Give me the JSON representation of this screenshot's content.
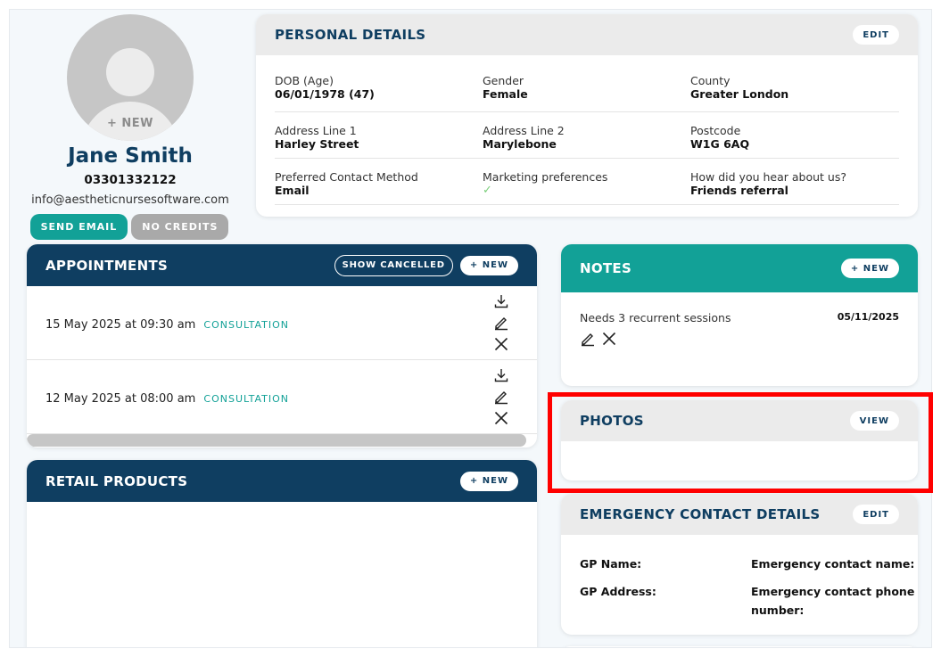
{
  "profile": {
    "avatar_new_label": "+ NEW",
    "name": "Jane Smith",
    "phone": "03301332122",
    "email": "info@aestheticnursesoftware.com",
    "send_email_label": "SEND EMAIL",
    "no_credits_label": "NO CREDITS"
  },
  "personal_details": {
    "title": "PERSONAL DETAILS",
    "edit_label": "EDIT",
    "rows": [
      [
        {
          "label": "DOB (Age)",
          "value": "06/01/1978 (47)"
        },
        {
          "label": "Gender",
          "value": "Female"
        },
        {
          "label": "County",
          "value": "Greater London"
        }
      ],
      [
        {
          "label": "Address Line 1",
          "value": "Harley Street"
        },
        {
          "label": "Address Line 2",
          "value": "Marylebone"
        },
        {
          "label": "Postcode",
          "value": "W1G 6AQ"
        }
      ],
      [
        {
          "label": "Preferred Contact Method",
          "value": "Email"
        },
        {
          "label": "Marketing preferences",
          "value": "✓"
        },
        {
          "label": "How did you hear about us?",
          "value": "Friends referral"
        }
      ]
    ]
  },
  "appointments": {
    "title": "APPOINTMENTS",
    "show_cancelled_label": "SHOW CANCELLED",
    "new_label": "+ NEW",
    "items": [
      {
        "datetime": "15 May 2025 at 09:30 am",
        "type": "CONSULTATION"
      },
      {
        "datetime": "12 May 2025 at 08:00 am",
        "type": "CONSULTATION"
      }
    ]
  },
  "retail_products": {
    "title": "RETAIL PRODUCTS",
    "new_label": "+ NEW"
  },
  "notes": {
    "title": "NOTES",
    "new_label": "+ NEW",
    "items": [
      {
        "text": "Needs 3 recurrent sessions",
        "date": "05/11/2025"
      }
    ]
  },
  "photos": {
    "title": "PHOTOS",
    "view_label": "VIEW"
  },
  "emergency": {
    "title": "EMERGENCY CONTACT DETAILS",
    "edit_label": "EDIT",
    "gp_name_label": "GP Name:",
    "gp_address_label": "GP Address:",
    "contact_name_label": "Emergency contact name:",
    "contact_phone_label": "Emergency contact phone number:"
  },
  "colors": {
    "navy": "#0f3e61",
    "teal": "#12a197",
    "grey_button": "#a9a9a9",
    "highlight": "#ff0000"
  },
  "icons": [
    "avatar-placeholder-icon",
    "download-icon",
    "edit-pencil-icon",
    "close-x-icon",
    "check-icon"
  ]
}
